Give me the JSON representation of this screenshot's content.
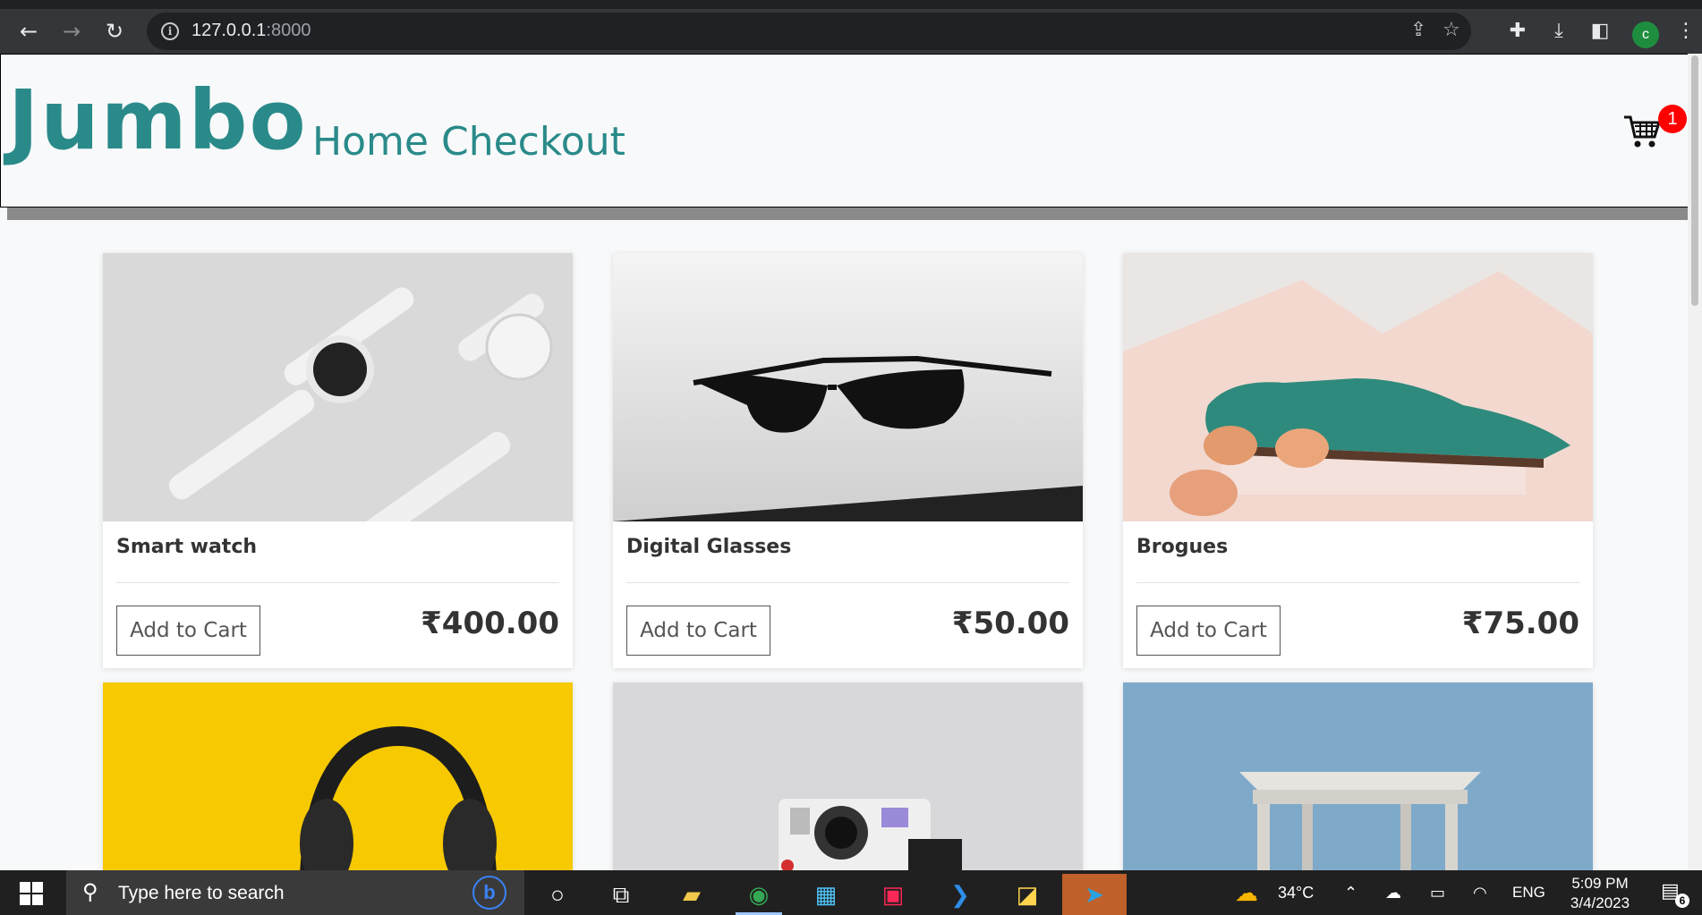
{
  "browser": {
    "url_host": "127.0.0.1",
    "url_port": ":8000",
    "profile_initial": "c"
  },
  "site": {
    "brand": "Jumbo",
    "nav": [
      "Home",
      "Checkout"
    ],
    "cart_count": "1"
  },
  "products": [
    {
      "name": "Smart watch",
      "button": "Add to Cart",
      "price": "₹400.00",
      "image": "white-smartwatches"
    },
    {
      "name": "Digital Glasses",
      "button": "Add to Cart",
      "price": "₹50.00",
      "image": "black-sunglasses"
    },
    {
      "name": "Brogues",
      "button": "Add to Cart",
      "price": "₹75.00",
      "image": "green-brogue-shoe"
    },
    {
      "name": "",
      "button": "",
      "price": "",
      "image": "headphones-yellow"
    },
    {
      "name": "",
      "button": "",
      "price": "",
      "image": "instant-camera"
    },
    {
      "name": "",
      "button": "",
      "price": "",
      "image": "wooden-stool"
    }
  ],
  "taskbar": {
    "search_placeholder": "Type here to search",
    "weather": "34°C",
    "language": "ENG",
    "time": "5:09 PM",
    "date": "3/4/2023",
    "notification_count": "6"
  },
  "colors": {
    "brand": "#2a8a8a",
    "badge": "#ff0000"
  }
}
